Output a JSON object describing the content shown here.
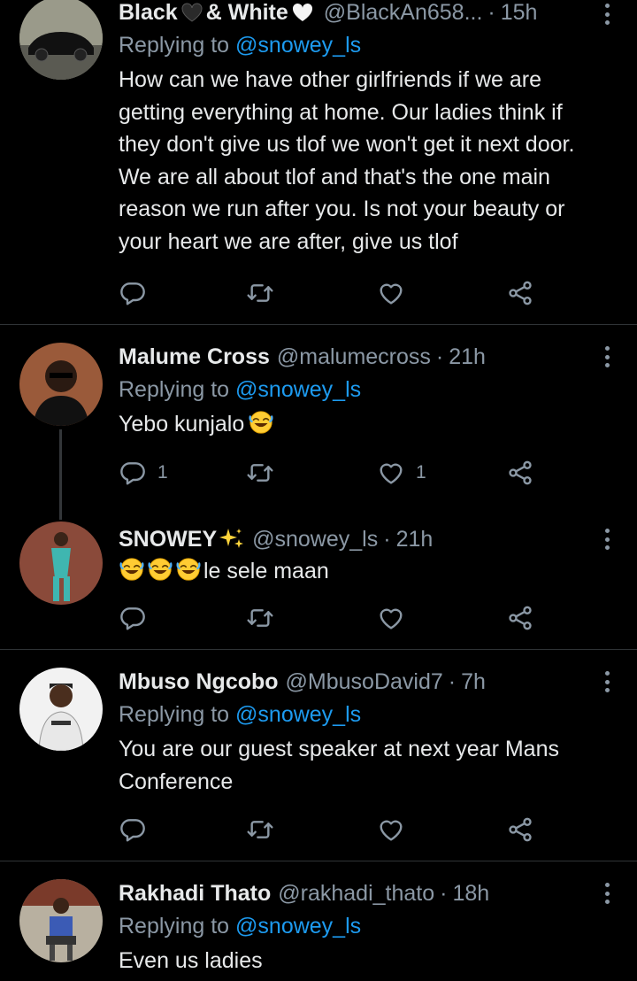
{
  "tweets": [
    {
      "name": "Black",
      "name_suffix": "& White",
      "handle": "@BlackAn658...",
      "dot": "·",
      "time": "15h",
      "reply_prefix": "Replying to",
      "reply_to": "@snowey_ls",
      "text": "How can we have other girlfriends if we are getting everything at home. Our ladies think if they don't give us tlof we won't get it next door. We are all about tlof and that's the one main reason we run after you. Is not your beauty or your heart we are after, give us tlof",
      "reply_count": "",
      "like_count": ""
    },
    {
      "name": "Malume Cross",
      "handle": "@malumecross",
      "dot": "·",
      "time": "21h",
      "reply_prefix": "Replying to",
      "reply_to": "@snowey_ls",
      "text": "Yebo kunjalo",
      "reply_count": "1",
      "like_count": "1"
    },
    {
      "name": "SNOWEY",
      "handle": "@snowey_ls",
      "dot": "·",
      "time": "21h",
      "text": "le sele maan",
      "reply_count": "",
      "like_count": ""
    },
    {
      "name": "Mbuso Ngcobo",
      "handle": "@MbusoDavid7",
      "dot": "·",
      "time": "7h",
      "reply_prefix": "Replying to",
      "reply_to": "@snowey_ls",
      "text": "You are our guest speaker at next year Mans Conference",
      "reply_count": "",
      "like_count": ""
    },
    {
      "name": "Rakhadi Thato",
      "handle": "@rakhadi_thato",
      "dot": "·",
      "time": "18h",
      "reply_prefix": "Replying to",
      "reply_to": "@snowey_ls",
      "text": "Even us ladies"
    }
  ],
  "icons": {
    "reply": "reply-icon",
    "retweet": "retweet-icon",
    "like": "like-icon",
    "share": "share-icon",
    "more": "more-icon"
  },
  "colors": {
    "background": "#000000",
    "primary_text": "#e7e9ea",
    "secondary_text": "#8b98a5",
    "link": "#1d9bf0",
    "divider": "#2f3336"
  }
}
